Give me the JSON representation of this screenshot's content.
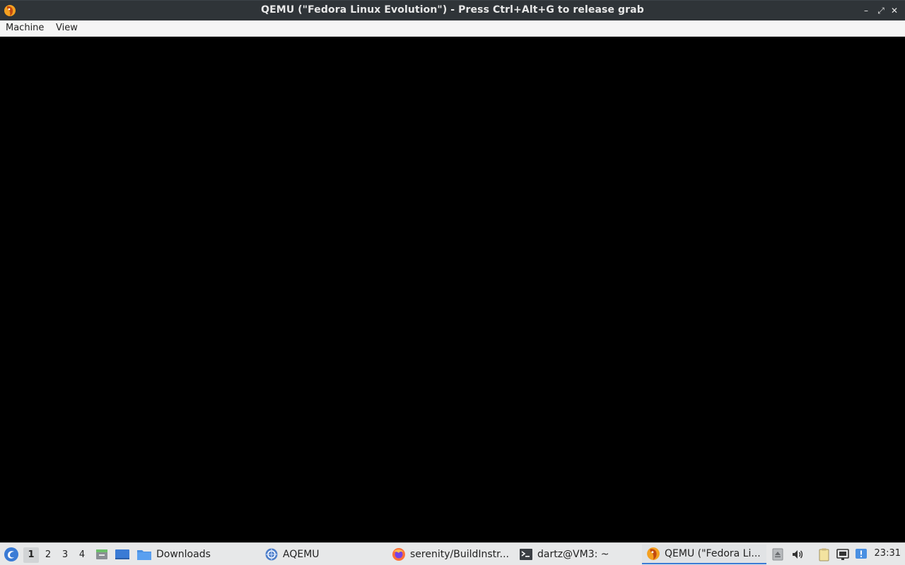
{
  "window": {
    "title": "QEMU (\"Fedora Linux Evolution\") - Press Ctrl+Alt+G to release grab",
    "icon": "qemu-icon",
    "controls": {
      "minimize": "–",
      "maximize": "⤢",
      "close": "✕"
    }
  },
  "menubar": {
    "items": [
      "Machine",
      "View"
    ]
  },
  "taskbar": {
    "start_icon": "lxqt-start-icon",
    "desktops": [
      "1",
      "2",
      "3",
      "4"
    ],
    "active_desktop": "1",
    "launchers": [
      "file-manager-icon",
      "show-desktop-icon"
    ],
    "tasks": [
      {
        "label": "Downloads",
        "icon": "folder-icon"
      },
      {
        "label": "AQEMU",
        "icon": "aqemu-icon"
      },
      {
        "label": "serenity/BuildInstr...",
        "icon": "firefox-icon"
      },
      {
        "label": "dartz@VM3: ~",
        "icon": "terminal-icon"
      },
      {
        "label": "QEMU (\"Fedora Li...",
        "icon": "qemu-icon",
        "active": true
      }
    ],
    "tray": [
      "eject-icon",
      "volume-icon",
      "clipboard-icon",
      "network-icon",
      "update-notifier-icon"
    ],
    "clock": "23:31"
  },
  "colors": {
    "titlebar_bg": "#2f3438",
    "accent": "#3a7bd5",
    "screen_bg": "#000000",
    "taskbar_bg": "#e7e8e9"
  }
}
